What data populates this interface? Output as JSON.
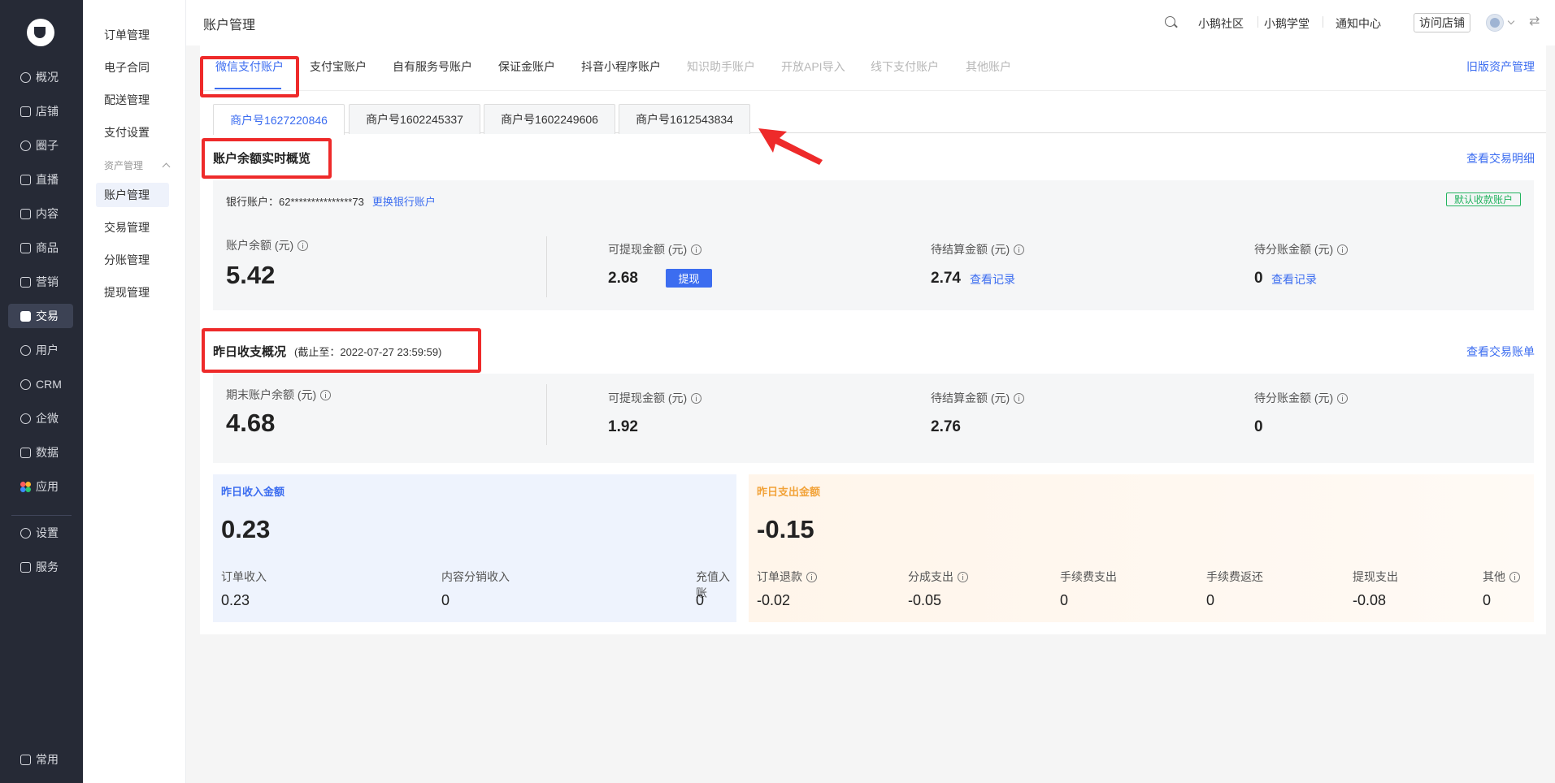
{
  "nav": {
    "items": [
      {
        "label": "概况",
        "icon": "pie-chart-icon"
      },
      {
        "label": "店铺",
        "icon": "shop-icon"
      },
      {
        "label": "圈子",
        "icon": "group-icon"
      },
      {
        "label": "直播",
        "icon": "live-icon"
      },
      {
        "label": "内容",
        "icon": "document-icon"
      },
      {
        "label": "商品",
        "icon": "box-icon"
      },
      {
        "label": "营销",
        "icon": "megaphone-icon"
      },
      {
        "label": "交易",
        "icon": "transaction-icon"
      },
      {
        "label": "用户",
        "icon": "user-icon"
      },
      {
        "label": "CRM",
        "icon": "crm-icon"
      },
      {
        "label": "企微",
        "icon": "wecom-icon"
      },
      {
        "label": "数据",
        "icon": "chart-icon"
      },
      {
        "label": "应用",
        "icon": "apps-icon"
      },
      {
        "label": "设置",
        "icon": "gear-icon"
      },
      {
        "label": "服务",
        "icon": "service-icon"
      }
    ],
    "bottom": {
      "label": "常用",
      "icon": "menu-icon"
    }
  },
  "subnav": {
    "items": [
      "订单管理",
      "电子合同",
      "配送管理",
      "支付设置"
    ],
    "group": "资产管理",
    "group_items": [
      "账户管理",
      "交易管理",
      "分账管理",
      "提现管理"
    ]
  },
  "header": {
    "title": "账户管理",
    "links": [
      "小鹅社区",
      "小鹅学堂",
      "通知中心"
    ],
    "visit": "访问店铺"
  },
  "tabs": [
    "微信支付账户",
    "支付宝账户",
    "自有服务号账户",
    "保证金账户",
    "抖音小程序账户",
    "知识助手账户",
    "开放API导入",
    "线下支付账户",
    "其他账户"
  ],
  "old_link": "旧版资产管理",
  "merchants": [
    "商户号1627220846",
    "商户号1602245337",
    "商户号1602249606",
    "商户号1612543834"
  ],
  "realtime": {
    "title": "账户余额实时概览",
    "link": "查看交易明细",
    "bank_label": "银行账户：62***************73",
    "change_bank": "更换银行账户",
    "default_badge": "默认收款账户",
    "balance_label": "账户余额 (元)",
    "balance": "5.42",
    "withdrawable_label": "可提现金额 (元)",
    "withdrawable": "2.68",
    "withdraw_btn": "提现",
    "pending_label": "待结算金额 (元)",
    "pending": "2.74",
    "split_label": "待分账金额 (元)",
    "split": "0",
    "view_record": "查看记录"
  },
  "yesterday": {
    "title": "昨日收支概况",
    "subtitle": "(截止至：2022-07-27 23:59:59)",
    "link": "查看交易账单",
    "end_balance_label": "期末账户余额 (元)",
    "end_balance": "4.68",
    "withdrawable_label": "可提现金额 (元)",
    "withdrawable": "1.92",
    "pending_label": "待结算金额 (元)",
    "pending": "2.76",
    "split_label": "待分账金额 (元)",
    "split": "0"
  },
  "income": {
    "title": "昨日收入金额",
    "total": "0.23",
    "items": [
      {
        "label": "订单收入",
        "value": "0.23"
      },
      {
        "label": "内容分销收入",
        "value": "0"
      },
      {
        "label": "充值入账",
        "value": "0"
      }
    ]
  },
  "expense": {
    "title": "昨日支出金额",
    "total": "-0.15",
    "items": [
      {
        "label": "订单退款",
        "value": "-0.02"
      },
      {
        "label": "分成支出",
        "value": "-0.05"
      },
      {
        "label": "手续费支出",
        "value": "0"
      },
      {
        "label": "手续费返还",
        "value": "0"
      },
      {
        "label": "提现支出",
        "value": "-0.08"
      },
      {
        "label": "其他",
        "value": "0"
      }
    ]
  },
  "colors": {
    "accent": "#3c6df0",
    "sidebar": "#262a36",
    "income_title": "#3c6df0",
    "expense_title": "#f2a33a",
    "badge": "#22b35e",
    "highlight": "#ee2a2a"
  }
}
